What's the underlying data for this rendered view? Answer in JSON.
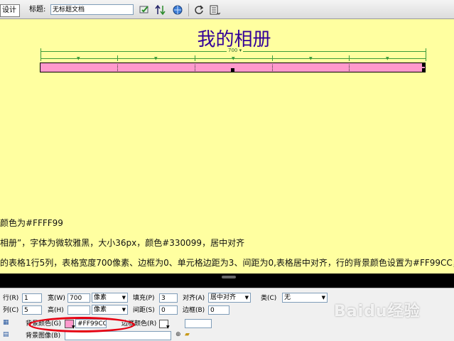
{
  "toolbar": {
    "design_label": "设计",
    "title_label": "标题:",
    "title_value": "无标题文档"
  },
  "canvas": {
    "page_title": "我的相册",
    "table_width_label": "700",
    "table_bg_color": "#FF99CC",
    "title_color": "#330099",
    "canvas_bg_color": "#FFFF99",
    "desc_lines": [
      "颜色为#FFFF99",
      "相册”，字体为微软雅黑，大小36px，颜色#330099，居中对齐",
      "的表格1行5列，表格宽度700像素、边框为0、单元格边距为3、间距为0,表格居中对齐，行的背景颜色设置为#FF99CC，"
    ]
  },
  "props": {
    "rows_label": "行(R)",
    "rows_value": "1",
    "cols_label": "列(C)",
    "cols_value": "5",
    "width_label": "宽(W)",
    "width_value": "700",
    "width_unit": "像素",
    "height_label": "高(H)",
    "height_value": "",
    "height_unit": "像素",
    "padding_label": "填充(P)",
    "padding_value": "3",
    "spacing_label": "间距(S)",
    "spacing_value": "0",
    "align_label": "对齐(A)",
    "align_value": "居中对齐",
    "border_label": "边框(B)",
    "border_value": "0",
    "class_label": "类(C)",
    "class_value": "无",
    "bgcolor_label": "背景颜色(G)",
    "bgcolor_value": "#FF99CC",
    "bordercolor_label": "边框颜色(R)",
    "bgimage_label": "背景图像(B)"
  },
  "watermark": "Baidu经验"
}
